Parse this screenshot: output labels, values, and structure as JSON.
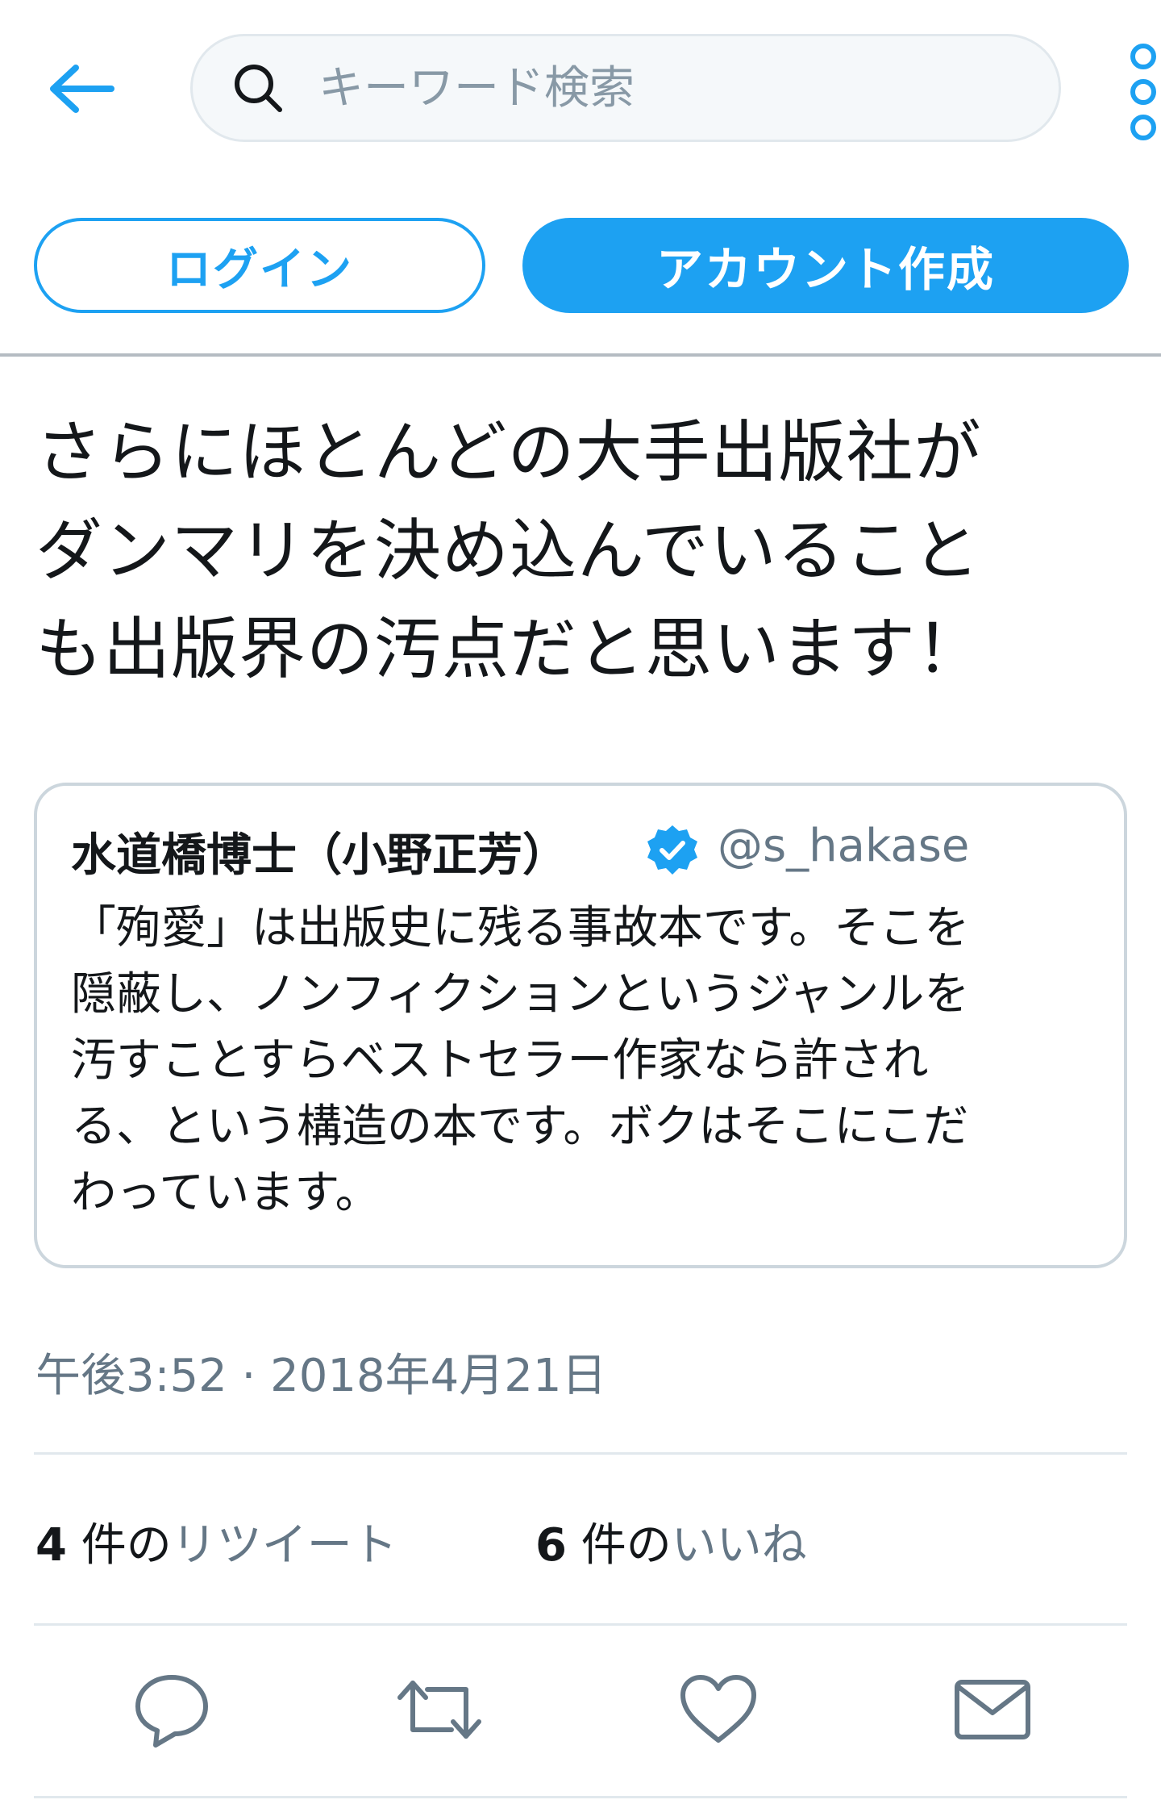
{
  "header": {
    "search_placeholder": "キーワード検索"
  },
  "auth": {
    "login_label": "ログイン",
    "signup_label": "アカウント作成"
  },
  "tweet": {
    "text": "さらにほとんどの大手出版社が\nダンマリを決め込んでいること\nも出版界の汚点だと思います！",
    "timestamp": "午後3:52 · 2018年4月21日",
    "retweets": {
      "count": "4",
      "unit": " 件の",
      "label": "リツイート"
    },
    "likes": {
      "count": "6",
      "unit": " 件の",
      "label": "いいね"
    }
  },
  "quote": {
    "name": "水道橋博士（小野正芳）",
    "handle": "@s_hakase",
    "text": "「殉愛」は出版史に残る事故本です。そこを\n隠蔽し、ノンフィクションというジャンルを\n汚すことすらベストセラー作家なら許され\nる、という構造の本です。ボクはそこにこだ\nわっています。"
  },
  "icons": {
    "back": "back-arrow-icon",
    "search": "search-icon",
    "more": "more-vertical-icon",
    "verified": "verified-badge-icon",
    "reply": "reply-icon",
    "retweet": "retweet-icon",
    "like": "heart-icon",
    "share": "mail-icon"
  },
  "colors": {
    "accent": "#1da1f2",
    "secondary_text": "#657786",
    "border": "#ccd6dd"
  }
}
